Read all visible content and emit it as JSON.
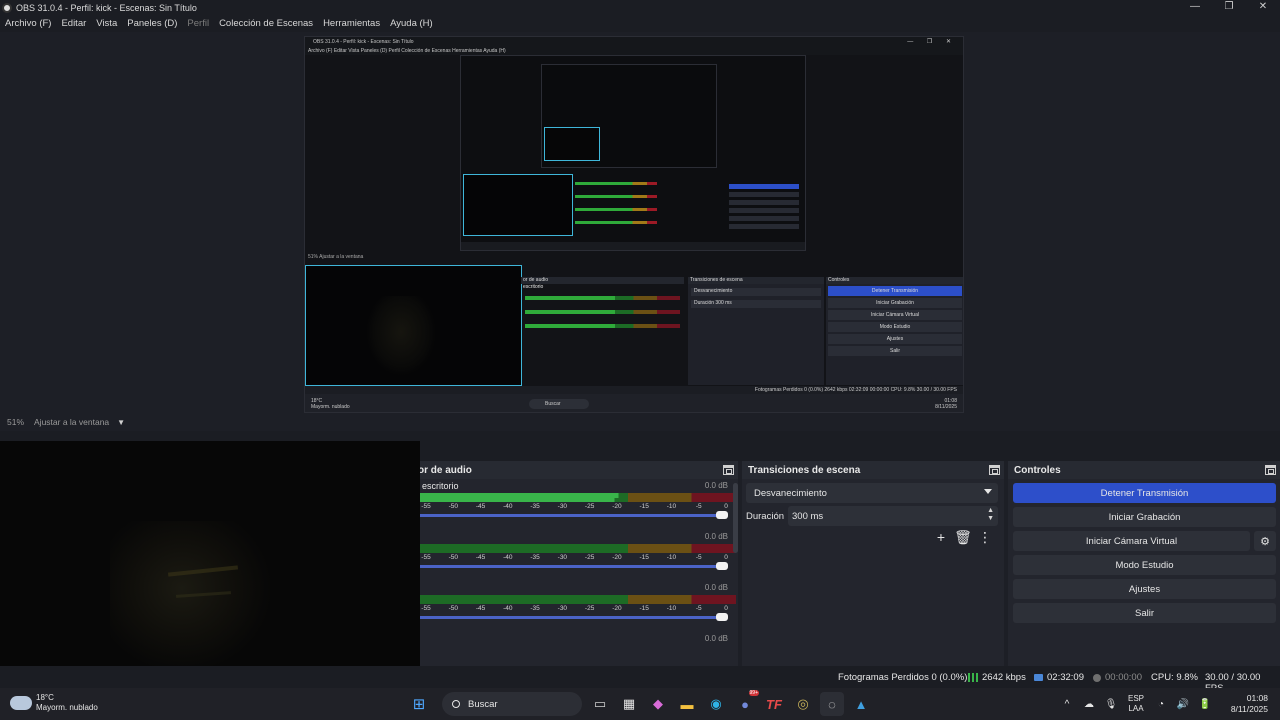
{
  "window": {
    "title": "OBS 31.0.4 - Perfil: kick - Escenas: Sin Título",
    "controls": [
      "—",
      "❐",
      "✕"
    ]
  },
  "menu": [
    {
      "label": "Archivo (F)",
      "enabled": true
    },
    {
      "label": "Editar",
      "enabled": true
    },
    {
      "label": "Vista",
      "enabled": true
    },
    {
      "label": "Paneles (D)",
      "enabled": true
    },
    {
      "label": "Perfil",
      "enabled": false
    },
    {
      "label": "Colección de Escenas",
      "enabled": true
    },
    {
      "label": "Herramientas",
      "enabled": true
    },
    {
      "label": "Ayuda (H)",
      "enabled": true
    }
  ],
  "zoom": {
    "percent": "51%",
    "mode": "Ajustar a la ventana"
  },
  "audio_mixer": {
    "title": "or de audio",
    "channels": [
      {
        "name": "escritorio",
        "db": "0.0 dB",
        "level": 0.63
      },
      {
        "name": "",
        "db": "0.0 dB",
        "level": 0.0
      },
      {
        "name": "",
        "db": "0.0 dB",
        "level": 0.0
      },
      {
        "name": "",
        "db": "0.0 dB",
        "level": 0.0
      }
    ],
    "ticks": [
      "-55",
      "-50",
      "-45",
      "-40",
      "-35",
      "-30",
      "-25",
      "-20",
      "-15",
      "-10",
      "-5",
      "0"
    ]
  },
  "transitions": {
    "title": "Transiciones de escena",
    "selected": "Desvanecimiento",
    "duration_label": "Duración",
    "duration_value": "300 ms",
    "tools": [
      "+",
      "🗑",
      "⋮"
    ]
  },
  "controls": {
    "title": "Controles",
    "stop_stream": "Detener Transmisión",
    "start_recording": "Iniciar Grabación",
    "start_virtual_cam": "Iniciar Cámara Virtual",
    "studio_mode": "Modo Estudio",
    "settings": "Ajustes",
    "exit": "Salir",
    "gear": "⚙"
  },
  "status": {
    "dropped": "Fotogramas Perdidos 0 (0.0%)",
    "bitrate": "2642 kbps",
    "live_time": "02:32:09",
    "rec_time": "00:00:00",
    "cpu": "CPU: 9.8%",
    "fps": "30.00 / 30.00 FPS"
  },
  "taskbar": {
    "weather_temp": "18°C",
    "weather_desc": "Mayorm. nublado",
    "search": "Buscar",
    "lang_top": "ESP",
    "lang_bottom": "LAA",
    "time": "01:08",
    "date": "8/11/2025",
    "tray_icons": [
      "^",
      "☁",
      "🎙",
      "🔊",
      "🔋"
    ],
    "badge": "99+"
  },
  "nested": {
    "title": "OBS 31.0.4 - Perfil: kick - Escenas: Sin Título",
    "menu": "Archivo (F)   Editar   Vista   Paneles (D)   Perfil   Colección de Escenas   Herramientas   Ayuda (H)",
    "zoom": "51%    Ajustar a la ventana",
    "audio_title": "or de audio",
    "audio_source": "escritorio",
    "trans_title": "Transiciones de escena",
    "trans_selected": "Desvanecimiento",
    "trans_duration": "Duración   300 ms",
    "ctrl_title": "Controles",
    "ctrl_buttons": [
      "Detener Transmisión",
      "Iniciar Grabación",
      "Iniciar Cámara Virtual",
      "Modo Estudio",
      "Ajustes",
      "Salir"
    ],
    "status": "Fotogramas Perdidos 0 (0.0%)    2642 kbps    02:32:09    00:00:00    CPU: 9.8%    30.00 / 30.00 FPS",
    "weather": "18°C",
    "weather_desc": "Mayorm. nublado",
    "search": "Buscar",
    "clock": "01:08",
    "date": "8/11/2025"
  },
  "colors": {
    "accent_blue": "#2d4fca",
    "preview_border": "#3fb6d9",
    "meter_green": "#39b54a",
    "meter_yellow": "#a27a18",
    "meter_red": "#9c1a26"
  }
}
